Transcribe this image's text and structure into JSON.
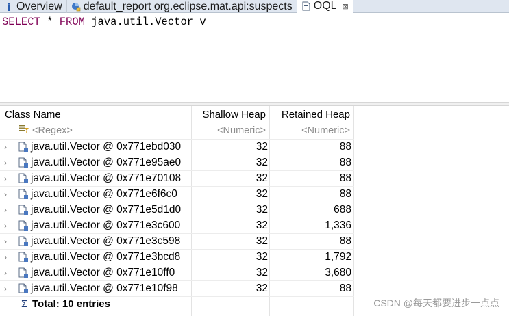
{
  "tabs": [
    {
      "label": "Overview",
      "icon": "info-icon"
    },
    {
      "label": "default_report  org.eclipse.mat.api:suspects",
      "icon": "report-icon"
    },
    {
      "label": "OQL",
      "icon": "oql-icon",
      "active": true,
      "close": "⊠"
    }
  ],
  "query": {
    "kw1": "SELECT",
    "mid1": " * ",
    "kw2": "FROM",
    "rest": " java.util.Vector v"
  },
  "table": {
    "columns": [
      "Class Name",
      "Shallow Heap",
      "Retained Heap"
    ],
    "filters": [
      "<Regex>",
      "<Numeric>",
      "<Numeric>"
    ],
    "rows": [
      {
        "name": "java.util.Vector @ 0x771ebd030",
        "shallow": "32",
        "retained": "88"
      },
      {
        "name": "java.util.Vector @ 0x771e95ae0",
        "shallow": "32",
        "retained": "88"
      },
      {
        "name": "java.util.Vector @ 0x771e70108",
        "shallow": "32",
        "retained": "88"
      },
      {
        "name": "java.util.Vector @ 0x771e6f6c0",
        "shallow": "32",
        "retained": "88"
      },
      {
        "name": "java.util.Vector @ 0x771e5d1d0",
        "shallow": "32",
        "retained": "688"
      },
      {
        "name": "java.util.Vector @ 0x771e3c600",
        "shallow": "32",
        "retained": "1,336"
      },
      {
        "name": "java.util.Vector @ 0x771e3c598",
        "shallow": "32",
        "retained": "88"
      },
      {
        "name": "java.util.Vector @ 0x771e3bcd8",
        "shallow": "32",
        "retained": "1,792"
      },
      {
        "name": "java.util.Vector @ 0x771e10ff0",
        "shallow": "32",
        "retained": "3,680"
      },
      {
        "name": "java.util.Vector @ 0x771e10f98",
        "shallow": "32",
        "retained": "88"
      }
    ],
    "total": "Total: 10 entries"
  },
  "watermark": "CSDN @每天都要进步一点点"
}
